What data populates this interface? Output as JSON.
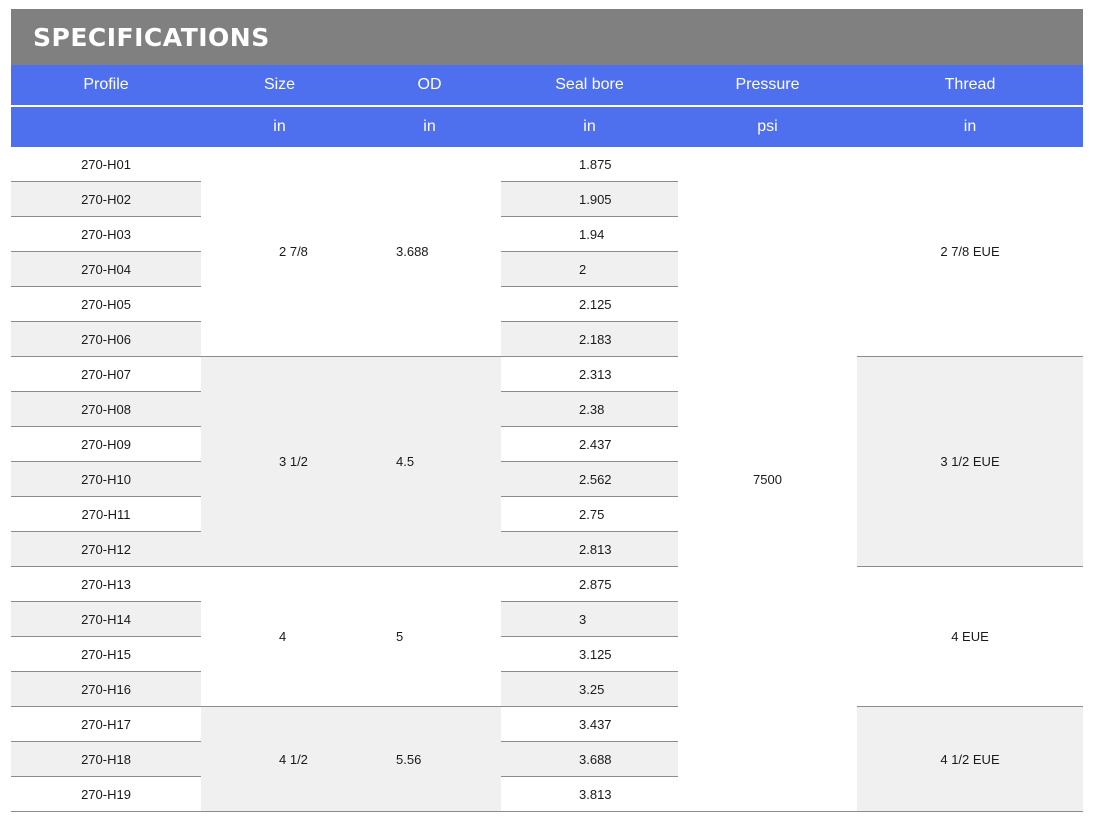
{
  "title": "SPECIFICATIONS",
  "headers": [
    "Profile",
    "Size",
    "OD",
    "Seal bore",
    "Pressure",
    "Thread"
  ],
  "units": [
    "",
    "in",
    "in",
    "in",
    "psi",
    "in"
  ],
  "pressure": "7500",
  "groups": [
    {
      "size": "2 7/8",
      "od": "3.688",
      "thread": "2 7/8 EUE",
      "rows": [
        {
          "profile": "270-H01",
          "seal_bore": "1.875"
        },
        {
          "profile": "270-H02",
          "seal_bore": "1.905"
        },
        {
          "profile": "270-H03",
          "seal_bore": "1.94"
        },
        {
          "profile": "270-H04",
          "seal_bore": "2"
        },
        {
          "profile": "270-H05",
          "seal_bore": "2.125"
        },
        {
          "profile": "270-H06",
          "seal_bore": "2.183"
        }
      ]
    },
    {
      "size": "3 1/2",
      "od": "4.5",
      "thread": "3 1/2 EUE",
      "rows": [
        {
          "profile": "270-H07",
          "seal_bore": "2.313"
        },
        {
          "profile": "270-H08",
          "seal_bore": "2.38"
        },
        {
          "profile": "270-H09",
          "seal_bore": "2.437"
        },
        {
          "profile": "270-H10",
          "seal_bore": "2.562"
        },
        {
          "profile": "270-H11",
          "seal_bore": "2.75"
        },
        {
          "profile": "270-H12",
          "seal_bore": "2.813"
        }
      ]
    },
    {
      "size": "4",
      "od": "5",
      "thread": "4 EUE",
      "rows": [
        {
          "profile": "270-H13",
          "seal_bore": "2.875"
        },
        {
          "profile": "270-H14",
          "seal_bore": "3"
        },
        {
          "profile": "270-H15",
          "seal_bore": "3.125"
        },
        {
          "profile": "270-H16",
          "seal_bore": "3.25"
        }
      ]
    },
    {
      "size": "4 1/2",
      "od": "5.56",
      "thread": "4 1/2 EUE",
      "rows": [
        {
          "profile": "270-H17",
          "seal_bore": "3.437"
        },
        {
          "profile": "270-H18",
          "seal_bore": "3.688"
        },
        {
          "profile": "270-H19",
          "seal_bore": "3.813"
        }
      ]
    }
  ]
}
